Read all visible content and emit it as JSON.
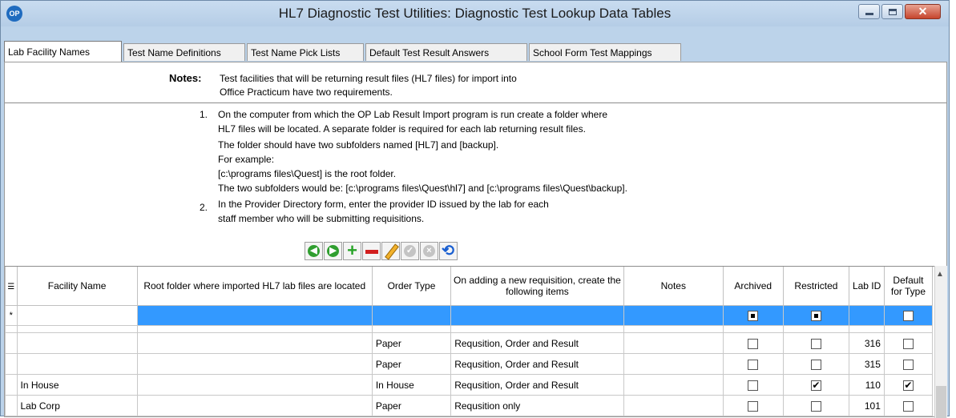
{
  "window": {
    "title": "HL7 Diagnostic Test Utilities:  Diagnostic Test Lookup Data Tables",
    "app_icon": "op-logo",
    "close_glyph": "✕"
  },
  "tabs": [
    {
      "label": "Lab Facility Names",
      "active": true
    },
    {
      "label": "Test Name Definitions"
    },
    {
      "label": "Test Name Pick Lists"
    },
    {
      "label": "Default Test Result Answers"
    },
    {
      "label": "School Form Test Mappings"
    }
  ],
  "notes": {
    "label": "Notes:",
    "line1": "Test facilities that will be returning result files (HL7 files) for import into",
    "line2": "Office Practicum have two requirements."
  },
  "steps": {
    "n1": "1.",
    "s1_l1": "On the computer from which the OP Lab Result Import program is run create a folder where",
    "s1_l2": "HL7 files will be located.  A separate folder is required for each lab returning result files.",
    "s1_l3": "The folder should have two subfolders named [HL7] and [backup].",
    "s1_l4": "For example:",
    "s1_l5": "[c:\\programs files\\Quest] is the root folder.",
    "s1_l6": "The two subfolders would be:  [c:\\programs files\\Quest\\hl7] and  [c:\\programs files\\Quest\\backup].",
    "n2": "2.",
    "s2_l1": "In the Provider Directory form, enter the provider ID issued by the lab for each",
    "s2_l2": "staff member who will be submitting requisitions."
  },
  "toolbar": {
    "prev": "◀",
    "next": "▶",
    "refresh": "⟲"
  },
  "grid": {
    "columns": [
      "Facility Name",
      "Root folder where imported HL7 lab files are located",
      "Order Type",
      "On adding a new requisition, create the following items",
      "Notes",
      "Archived",
      "Restricted",
      "Lab ID",
      "Default for Type"
    ],
    "new_row_marker": "*",
    "rows": [
      {
        "facility": "",
        "root": "",
        "order_type": "Paper",
        "items": "Requsition, Order and Result",
        "notes": "",
        "archived": false,
        "restricted": false,
        "lab_id": "316",
        "default": false
      },
      {
        "facility": "",
        "root": "",
        "order_type": "Paper",
        "items": "Requsition, Order and Result",
        "notes": "",
        "archived": false,
        "restricted": false,
        "lab_id": "315",
        "default": false
      },
      {
        "facility": "In House",
        "root": "",
        "order_type": "In House",
        "items": "Requsition, Order and Result",
        "notes": "",
        "archived": false,
        "restricted": true,
        "lab_id": "110",
        "default": true
      },
      {
        "facility": "Lab Corp",
        "root": "",
        "order_type": "Paper",
        "items": "Requsition only",
        "notes": "",
        "archived": false,
        "restricted": false,
        "lab_id": "101",
        "default": false
      }
    ],
    "check_glyph": "✔"
  },
  "colors": {
    "selected_row": "#3399ff",
    "title_bar": "#bcd3ea"
  }
}
